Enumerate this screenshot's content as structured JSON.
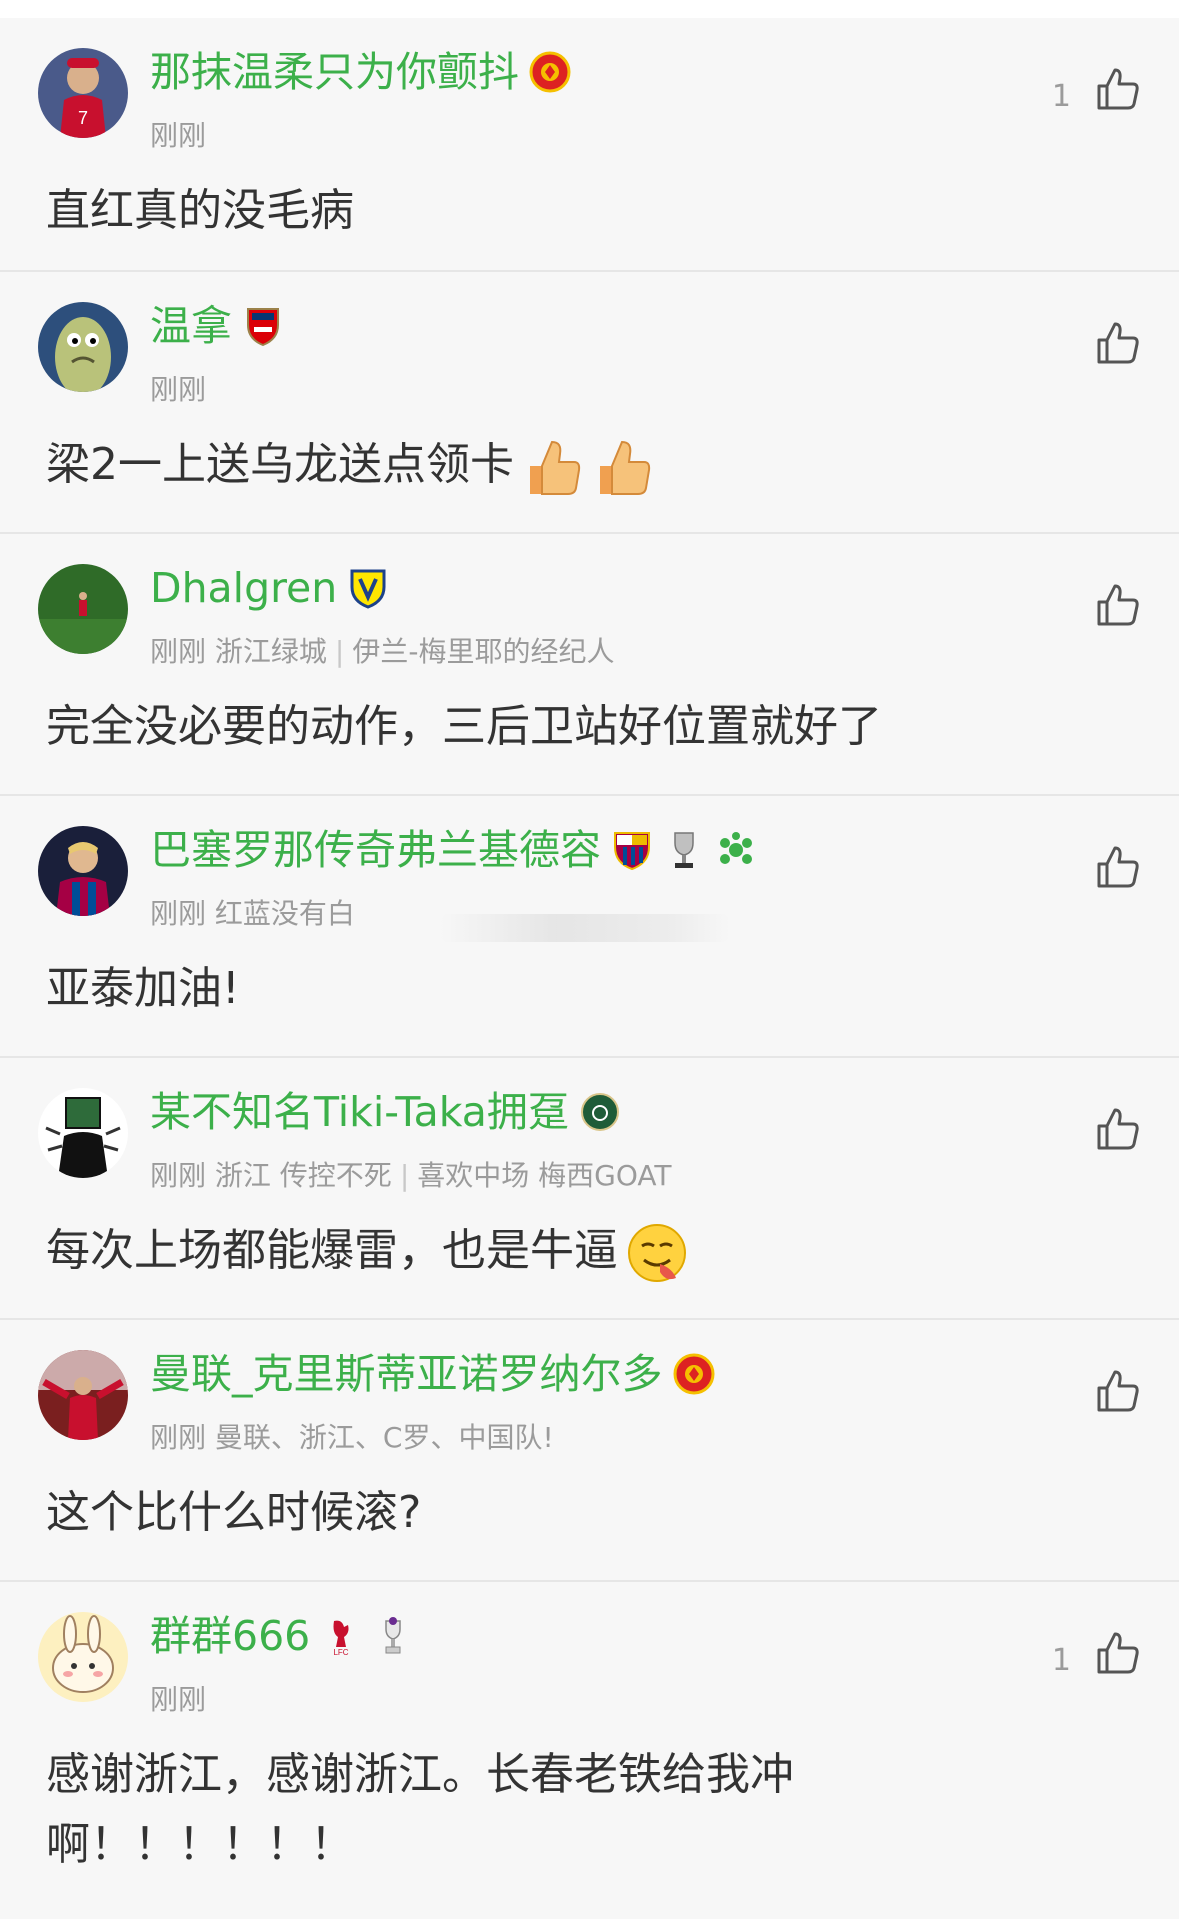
{
  "colors": {
    "username": "#3cb04a",
    "meta": "#9b9b9b",
    "content": "#333333",
    "background": "#f7f7f7",
    "divider": "#e6e6e6"
  },
  "comments": [
    {
      "username": "那抹温柔只为你颤抖",
      "badges": [
        "man-utd-crest-icon"
      ],
      "meta": "刚刚",
      "like_count": "1",
      "content": "直红真的没毛病"
    },
    {
      "username": "温拿",
      "badges": [
        "arsenal-crest-icon"
      ],
      "meta": "刚刚",
      "like_count": "",
      "content": "梁2一上送乌龙送点领卡",
      "emojis": [
        "thumbs-up-emoji",
        "thumbs-up-emoji"
      ]
    },
    {
      "username": "Dhalgren",
      "badges": [
        "leeds-crest-icon"
      ],
      "meta": "刚刚 浙江绿城",
      "meta_extra": "伊兰-梅里耶的经纪人",
      "like_count": "",
      "content": "完全没必要的动作，三后卫站好位置就好了"
    },
    {
      "username": "巴塞罗那传奇弗兰基德容",
      "badges": [
        "barcelona-crest-icon",
        "trophy-icon",
        "green-emblem-icon"
      ],
      "meta": "刚刚 红蓝没有白",
      "like_count": "",
      "content": "亚泰加油!"
    },
    {
      "username": "某不知名Tiki-Taka拥趸",
      "badges": [
        "zhejiang-crest-icon"
      ],
      "meta": "刚刚 浙江 传控不死",
      "meta_extra": "喜欢中场 梅西GOAT",
      "like_count": "",
      "content": "每次上场都能爆雷，也是牛逼",
      "emojis": [
        "smirk-tongue-emoji"
      ]
    },
    {
      "username": "曼联_克里斯蒂亚诺罗纳尔多",
      "badges": [
        "man-utd-crest-icon"
      ],
      "meta": "刚刚 曼联、浙江、C罗、中国队!",
      "like_count": "",
      "content": "这个比什么时候滚?"
    },
    {
      "username": "群群666",
      "badges": [
        "liverpool-crest-icon",
        "premier-league-trophy-icon"
      ],
      "meta": "刚刚",
      "like_count": "1",
      "content": "感谢浙江，感谢浙江。长春老铁给我冲",
      "content_line2": "啊！！！！！！"
    }
  ]
}
